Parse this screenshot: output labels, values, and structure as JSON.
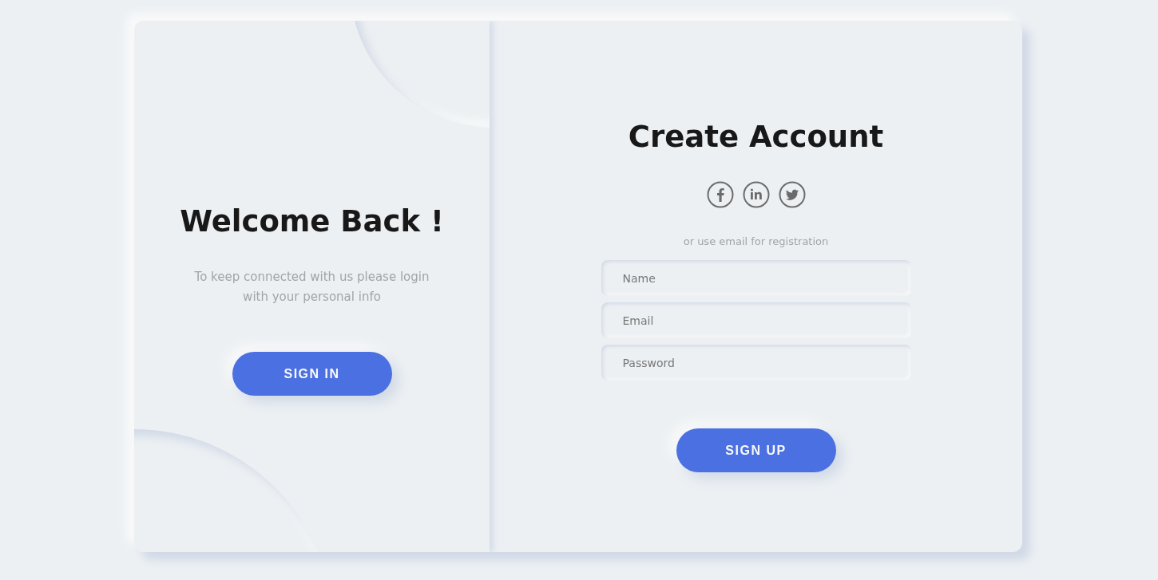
{
  "welcome": {
    "title": "Welcome Back !",
    "text": "To keep connected with us please login with your personal info",
    "button": "SIGN IN"
  },
  "signup": {
    "title": "Create Account",
    "socials": [
      {
        "kind": "facebook"
      },
      {
        "kind": "linkedin"
      },
      {
        "kind": "twitter"
      }
    ],
    "hint": "or use email for registration",
    "fields": [
      {
        "placeholder": "Name"
      },
      {
        "placeholder": "Email"
      },
      {
        "placeholder": "Password"
      }
    ],
    "button": "SIGN UP"
  }
}
